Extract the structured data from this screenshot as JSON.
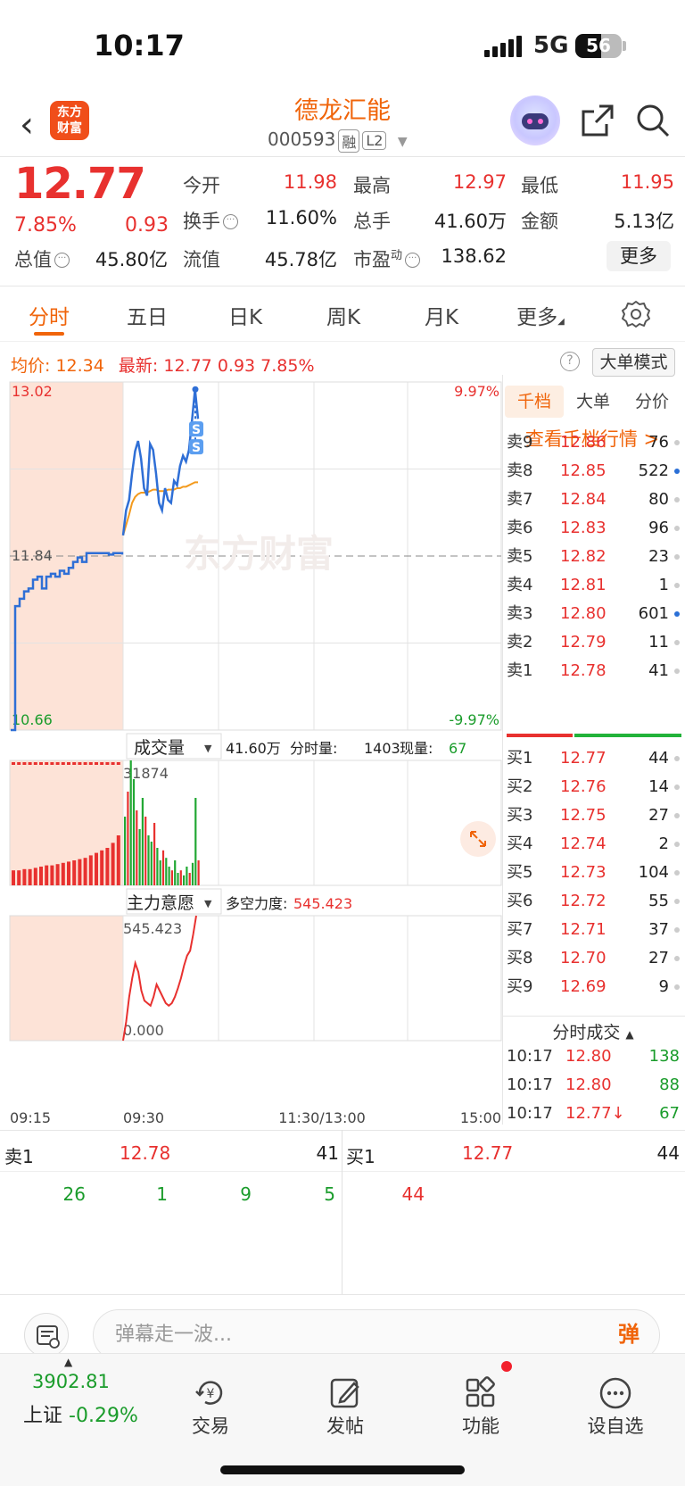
{
  "status_bar": {
    "time": "10:17",
    "network": "5G",
    "battery": "56",
    "battery_level": 0.56
  },
  "header": {
    "back_icon": "back-icon",
    "logo_text": "东方财富",
    "stock_name": "德龙汇能",
    "stock_code": "000593",
    "tags": [
      "融",
      "L2"
    ]
  },
  "quote": {
    "price": "12.77",
    "change_pct": "7.85%",
    "change": "0.93",
    "fields": [
      {
        "label": "今开",
        "value": "11.98",
        "color": "red"
      },
      {
        "label": "最高",
        "value": "12.97",
        "color": "red"
      },
      {
        "label": "最低",
        "value": "11.95",
        "color": "red"
      },
      {
        "label": "换手",
        "value": "11.60%",
        "color": "black"
      },
      {
        "label": "总手",
        "value": "41.60万",
        "color": "black"
      },
      {
        "label": "金额",
        "value": "5.13亿",
        "color": "black"
      },
      {
        "label": "总值",
        "value": "45.80亿",
        "color": "black"
      },
      {
        "label": "流值",
        "value": "45.78亿",
        "color": "black"
      },
      {
        "label": "市盈",
        "label_sup": "动",
        "value": "138.62",
        "color": "black"
      }
    ],
    "more_label": "更多"
  },
  "tabs": [
    "分时",
    "五日",
    "日K",
    "周K",
    "月K",
    "更多"
  ],
  "chart_header": {
    "avg_label": "均价:",
    "avg_value": "12.34",
    "latest_label": "最新:",
    "latest_value": "12.77",
    "latest_change": "0.93",
    "latest_pct": "7.85%",
    "big_order_label": "大单模式"
  },
  "chart_data": [
    {
      "type": "line",
      "title": "分时",
      "y_labels_left": [
        "13.02",
        "11.84",
        "10.66"
      ],
      "y_labels_right": [
        "9.97%",
        "-9.97%"
      ],
      "ylim": [
        10.66,
        13.02
      ],
      "prev_close": 11.84,
      "x_labels": [
        "09:15",
        "09:30",
        "11:30/13:00",
        "15:00"
      ],
      "watermark": "东方财富",
      "markers": [
        "S",
        "S"
      ],
      "series": [
        {
          "name": "auction",
          "color": "#2f6fd6",
          "values": [
            10.66,
            11.5,
            11.55,
            11.6,
            11.62,
            11.68,
            11.7,
            11.62,
            11.7,
            11.72,
            11.7,
            11.74,
            11.72,
            11.76,
            11.8,
            11.83,
            11.8,
            11.86,
            11.86,
            11.86,
            11.86,
            11.86,
            11.85,
            11.86,
            11.86,
            11.85
          ]
        },
        {
          "name": "price",
          "color": "#2f6fd6",
          "values": [
            11.98,
            12.15,
            12.22,
            12.4,
            12.55,
            12.62,
            12.5,
            12.3,
            12.25,
            12.6,
            12.56,
            12.4,
            12.2,
            12.15,
            12.3,
            12.22,
            12.2,
            12.35,
            12.32,
            12.45,
            12.52,
            12.48,
            12.56,
            12.76,
            12.97,
            12.77
          ]
        },
        {
          "name": "avg",
          "color": "#f39a1d",
          "values": [
            11.98,
            12.05,
            12.12,
            12.2,
            12.24,
            12.26,
            12.27,
            12.27,
            12.27,
            12.28,
            12.29,
            12.29,
            12.28,
            12.28,
            12.28,
            12.29,
            12.29,
            12.29,
            12.3,
            12.3,
            12.31,
            12.31,
            12.32,
            12.33,
            12.34,
            12.34
          ]
        }
      ]
    },
    {
      "type": "bar",
      "title": "成交量",
      "summary_total": "41.60万",
      "summary_fen": "分时量:",
      "summary_fen_value": "1403",
      "summary_now": "现量:",
      "summary_now_value": "67",
      "max_label": "31874",
      "auction_values": [
        0.12,
        0.12,
        0.13,
        0.13,
        0.14,
        0.15,
        0.16,
        0.16,
        0.17,
        0.18,
        0.19,
        0.2,
        0.21,
        0.22,
        0.24,
        0.26,
        0.28,
        0.3,
        0.34,
        0.4
      ],
      "values": [
        0.55,
        0.75,
        1.0,
        0.85,
        0.6,
        0.45,
        0.7,
        0.55,
        0.4,
        0.35,
        0.5,
        0.3,
        0.2,
        0.28,
        0.22,
        0.15,
        0.12,
        0.2,
        0.1,
        0.12,
        0.08,
        0.15,
        0.1,
        0.18,
        0.7,
        0.2
      ]
    },
    {
      "type": "line",
      "title": "主力意愿",
      "indicator_label": "多空力度:",
      "indicator_value": "545.423",
      "max_label": "545.423",
      "min_label": "0.000",
      "values": [
        0.0,
        0.15,
        0.35,
        0.5,
        0.62,
        0.55,
        0.4,
        0.32,
        0.3,
        0.28,
        0.35,
        0.45,
        0.4,
        0.35,
        0.3,
        0.28,
        0.3,
        0.35,
        0.42,
        0.5,
        0.6,
        0.68,
        0.72,
        0.85,
        1.0
      ]
    }
  ],
  "order_book": {
    "tabs": [
      "千档",
      "大单",
      "分价"
    ],
    "view_depth_label": "查看千档行情 >",
    "asks": [
      {
        "label": "卖9",
        "price": "12.86",
        "qty": "76",
        "dot": "gray"
      },
      {
        "label": "卖8",
        "price": "12.85",
        "qty": "522",
        "dot": "blue"
      },
      {
        "label": "卖7",
        "price": "12.84",
        "qty": "80",
        "dot": "gray"
      },
      {
        "label": "卖6",
        "price": "12.83",
        "qty": "96",
        "dot": "gray"
      },
      {
        "label": "卖5",
        "price": "12.82",
        "qty": "23",
        "dot": "gray"
      },
      {
        "label": "卖4",
        "price": "12.81",
        "qty": "1",
        "dot": "gray"
      },
      {
        "label": "卖3",
        "price": "12.80",
        "qty": "601",
        "dot": "blue"
      },
      {
        "label": "卖2",
        "price": "12.79",
        "qty": "11",
        "dot": "gray"
      },
      {
        "label": "卖1",
        "price": "12.78",
        "qty": "41",
        "dot": "gray"
      }
    ],
    "buy_ratio": 0.38,
    "bids": [
      {
        "label": "买1",
        "price": "12.77",
        "qty": "44",
        "dot": "gray"
      },
      {
        "label": "买2",
        "price": "12.76",
        "qty": "14",
        "dot": "gray"
      },
      {
        "label": "买3",
        "price": "12.75",
        "qty": "27",
        "dot": "gray"
      },
      {
        "label": "买4",
        "price": "12.74",
        "qty": "2",
        "dot": "gray"
      },
      {
        "label": "买5",
        "price": "12.73",
        "qty": "104",
        "dot": "gray"
      },
      {
        "label": "买6",
        "price": "12.72",
        "qty": "55",
        "dot": "gray"
      },
      {
        "label": "买7",
        "price": "12.71",
        "qty": "37",
        "dot": "gray"
      },
      {
        "label": "买8",
        "price": "12.70",
        "qty": "27",
        "dot": "gray"
      },
      {
        "label": "买9",
        "price": "12.69",
        "qty": "9",
        "dot": "gray"
      }
    ],
    "ticks_title": "分时成交",
    "ticks": [
      {
        "time": "10:17",
        "price": "12.80",
        "vol": "138"
      },
      {
        "time": "10:17",
        "price": "12.80",
        "vol": "88"
      },
      {
        "time": "10:17",
        "price": "12.77↓",
        "vol": "67"
      }
    ]
  },
  "level1": {
    "ask_label": "卖1",
    "ask_price": "12.78",
    "ask_qty": "41",
    "bid_label": "买1",
    "bid_price": "12.77",
    "bid_qty": "44",
    "ask_queue": [
      "26",
      "1",
      "9",
      "5"
    ],
    "bid_queue": [
      "44"
    ]
  },
  "danmu": {
    "placeholder": "弹幕走一波...",
    "toggle": "弹"
  },
  "bottom_nav": {
    "index_value": "3902.81",
    "index_name": "上证",
    "index_change": "-0.29%",
    "items": [
      {
        "label": "交易",
        "icon": "trade-icon"
      },
      {
        "label": "发帖",
        "icon": "post-icon"
      },
      {
        "label": "功能",
        "icon": "apps-icon"
      },
      {
        "label": "设自选",
        "icon": "add-watchlist-icon"
      }
    ]
  }
}
